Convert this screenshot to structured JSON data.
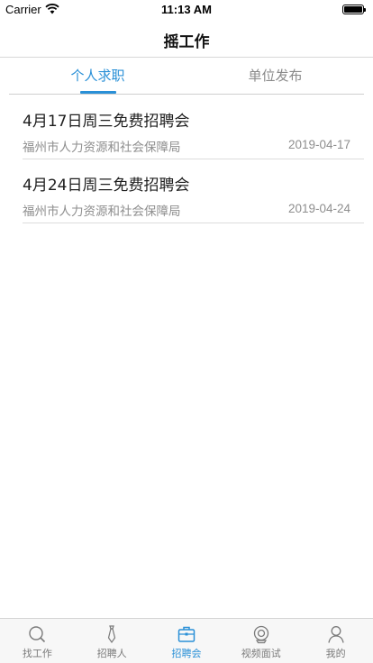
{
  "status_bar": {
    "carrier": "Carrier",
    "time": "11:13 AM"
  },
  "nav": {
    "title": "摇工作"
  },
  "segments": {
    "tabs": [
      {
        "label": "个人求职",
        "active": true
      },
      {
        "label": "单位发布",
        "active": false
      }
    ]
  },
  "list": {
    "items": [
      {
        "title": "4月17日周三免费招聘会",
        "org": "福州市人力资源和社会保障局",
        "date": "2019-04-17"
      },
      {
        "title": "4月24日周三免费招聘会",
        "org": "福州市人力资源和社会保障局",
        "date": "2019-04-24"
      }
    ]
  },
  "tab_bar": {
    "items": [
      {
        "label": "找工作",
        "icon": "search-icon",
        "active": false
      },
      {
        "label": "招聘人",
        "icon": "tie-icon",
        "active": false
      },
      {
        "label": "招聘会",
        "icon": "briefcase-icon",
        "active": true
      },
      {
        "label": "视频面试",
        "icon": "webcam-icon",
        "active": false
      },
      {
        "label": "我的",
        "icon": "person-icon",
        "active": false
      }
    ]
  },
  "colors": {
    "accent": "#2a90d7",
    "inactive": "#7a7a7a"
  }
}
